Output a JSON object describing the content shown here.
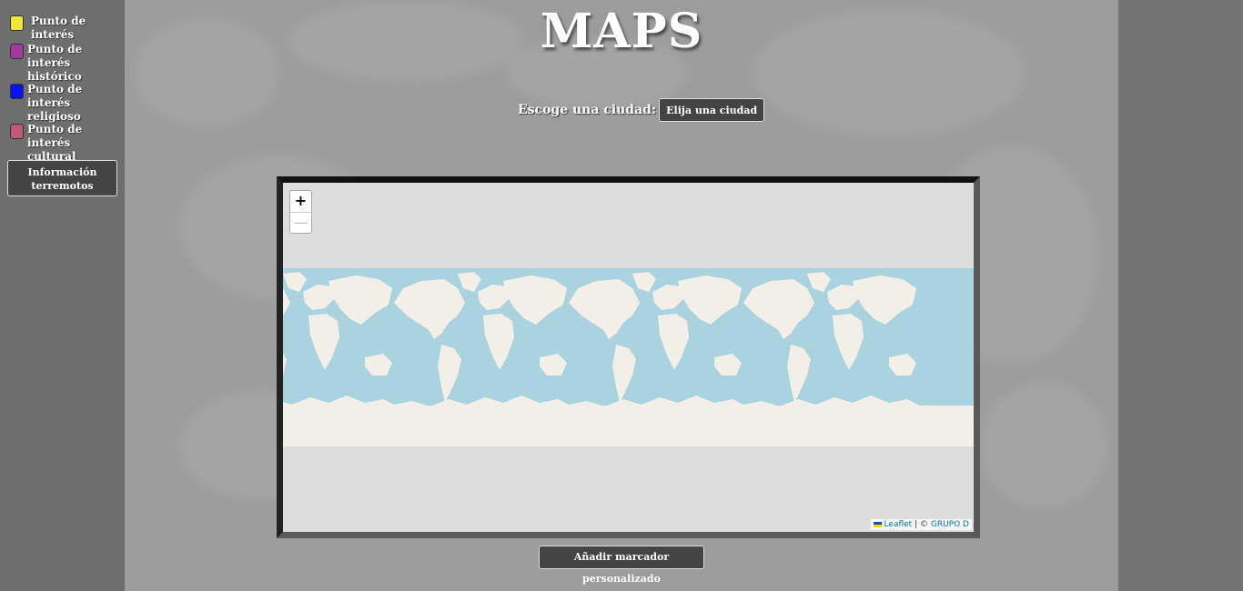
{
  "legend": [
    {
      "label": "Punto de interés",
      "color": "#f0e63c"
    },
    {
      "label": "Punto de interés histórico",
      "color": "#a238a0"
    },
    {
      "label": "Punto de interés religioso",
      "color": "#0a12f0"
    },
    {
      "label": "Punto de interés cultural",
      "color": "#c05878"
    }
  ],
  "info_button": "Información terremotos",
  "header": {
    "title": "MAPS",
    "city_label": "Escoge una ciudad:",
    "city_select_value": "Elija una ciudad"
  },
  "map": {
    "zoom_in": "+",
    "zoom_out": "—",
    "attribution_leaflet": "Leaflet",
    "attribution_sep": "|",
    "attribution_copy": "©",
    "attribution_group": "GRUPO D",
    "colors": {
      "ocean": "#aad3df",
      "land": "#f2efe9",
      "empty": "#dddddd"
    }
  },
  "add_marker_button": "Añadir marcador personalizado"
}
